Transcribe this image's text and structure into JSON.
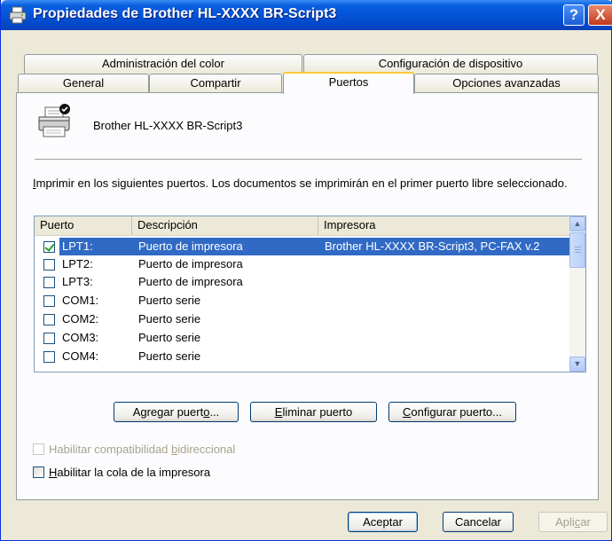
{
  "window": {
    "title": "Propiedades de Brother HL-XXXX BR-Script3"
  },
  "title_buttons": {
    "help": "?",
    "close": "X"
  },
  "tabs": {
    "row1": [
      "Administración del color",
      "Configuración de dispositivo"
    ],
    "row2": [
      "General",
      "Compartir",
      "Puertos",
      "Opciones avanzadas"
    ],
    "active": "Puertos"
  },
  "printer": {
    "name": "Brother HL-XXXX BR-Script3"
  },
  "instruction": {
    "accel": "I",
    "rest": "mprimir en los siguientes puertos. Los documentos se imprimirán en el primer puerto libre seleccionado."
  },
  "list": {
    "headers": [
      "Puerto",
      "Descripción",
      "Impresora"
    ],
    "rows": [
      {
        "port": "LPT1:",
        "desc": "Puerto de impresora",
        "printer": "Brother HL-XXXX BR-Script3, PC-FAX v.2",
        "checked": true,
        "selected": true
      },
      {
        "port": "LPT2:",
        "desc": "Puerto de impresora",
        "printer": "",
        "checked": false,
        "selected": false
      },
      {
        "port": "LPT3:",
        "desc": "Puerto de impresora",
        "printer": "",
        "checked": false,
        "selected": false
      },
      {
        "port": "COM1:",
        "desc": "Puerto serie",
        "printer": "",
        "checked": false,
        "selected": false
      },
      {
        "port": "COM2:",
        "desc": "Puerto serie",
        "printer": "",
        "checked": false,
        "selected": false
      },
      {
        "port": "COM3:",
        "desc": "Puerto serie",
        "printer": "",
        "checked": false,
        "selected": false
      },
      {
        "port": "COM4:",
        "desc": "Puerto serie",
        "printer": "",
        "checked": false,
        "selected": false
      }
    ]
  },
  "buttons": {
    "add_pre": "Agregar puert",
    "add_accel": "o",
    "add_post": "...",
    "remove_accel": "E",
    "remove_rest": "liminar puerto",
    "config_accel": "C",
    "config_rest": "onfigurar puerto..."
  },
  "checkboxes": {
    "bidir_pre": "Habilitar compatibilidad ",
    "bidir_accel": "b",
    "bidir_post": "idireccional",
    "bidir_enabled": false,
    "bidir_checked": false,
    "spool_accel": "H",
    "spool_rest": "abilitar la cola de la impresora",
    "spool_checked": false
  },
  "footer": {
    "ok": "Aceptar",
    "cancel": "Cancelar",
    "apply_pre": "Apli",
    "apply_accel": "c",
    "apply_post": "ar"
  },
  "colors": {
    "titlebar": "#0454d8",
    "selection": "#316ac5",
    "active_tab_accent": "#ffc73c",
    "window_bg": "#ece9d8"
  }
}
